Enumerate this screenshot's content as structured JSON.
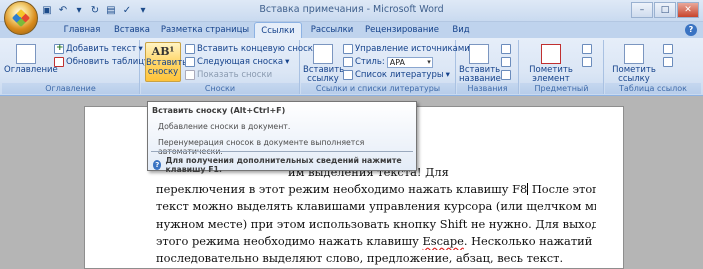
{
  "window": {
    "title": "Вставка примечания - Microsoft Word",
    "controls": [
      "–",
      "□",
      "✕"
    ]
  },
  "tabs": [
    "Главная",
    "Вставка",
    "Разметка страницы",
    "Ссылки",
    "Рассылки",
    "Рецензирование",
    "Вид"
  ],
  "ribbon": {
    "toc_group": {
      "label": "Оглавление",
      "toc_button": "Оглавление",
      "add_text": "Добавить текст",
      "update_table": "Обновить таблицу"
    },
    "footnotes_group": {
      "label": "Сноски",
      "insert_footnote_line1": "Вставить",
      "insert_footnote_line2": "сноску",
      "insert_endnote": "Вставить концевую сноску",
      "next_footnote": "Следующая сноска",
      "show_notes": "Показать сноски"
    },
    "citations_group": {
      "label": "Ссылки и списки литературы",
      "insert_citation_line1": "Вставить",
      "insert_citation_line2": "ссылку",
      "manage_sources": "Управление источниками",
      "style_label": "Стиль:",
      "style_value": "APA",
      "bibliography": "Список литературы"
    },
    "captions_group": {
      "label": "Названия",
      "insert_caption_line1": "Вставить",
      "insert_caption_line2": "название"
    },
    "index_group": {
      "label": "Предметный указатель",
      "mark_entry_line1": "Пометить",
      "mark_entry_line2": "элемент"
    },
    "toa_group": {
      "label": "Таблица ссылок",
      "mark_citation_line1": "Пометить",
      "mark_citation_line2": "ссылку"
    }
  },
  "tooltip": {
    "title": "Вставить сноску (Alt+Ctrl+F)",
    "description": "Добавление сноски в документ.",
    "note": "Перенумерация сносок в документе выполняется автоматически.",
    "help": "Для получения дополнительных сведений нажмите клавишу F1."
  },
  "document": {
    "lines": [
      "им выделения текста! Для",
      "переключения в этот режим необходимо нажать клавишу F8",
      " После этого",
      "текст можно выделять клавишами управления курсора (или щелчком мыши в",
      "нужном месте) при этом использовать кнопку Shift не нужно. Для выхода из",
      "этого режима необходимо нажать клавишу ",
      "Escape",
      ". Несколько нажатий F8",
      "последовательно выделяют слово, предложение, абзац, весь текст."
    ]
  }
}
